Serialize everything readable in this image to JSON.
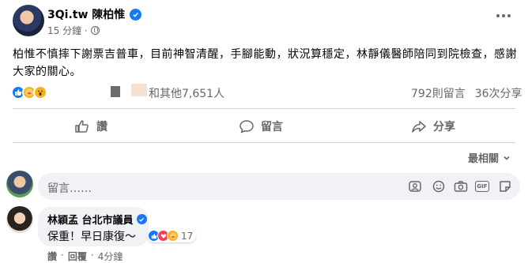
{
  "post": {
    "author": "3Qi.tw 陳柏惟",
    "time": "15 分鐘 ·",
    "text": "柏惟不慎摔下謝票吉普車，目前神智清醒，手腳能動，狀況算穩定，林靜儀醫師陪同到院檢查，感謝大家的關心。"
  },
  "reactions": {
    "icons": [
      "like-icon",
      "care-icon",
      "wow-icon"
    ],
    "others_text": "和其他7,651人",
    "comments_count": "792則留言",
    "shares_count": "36次分享"
  },
  "actions": {
    "like_label": "讚",
    "comment_label": "留言",
    "share_label": "分享"
  },
  "sort": {
    "label": "最相關"
  },
  "composer": {
    "placeholder": "留言……"
  },
  "comment": {
    "author": "林穎孟 台北市議員",
    "text": "保重！早日康復～",
    "reaction_count": "17",
    "like_label": "讚",
    "reply_label": "回覆",
    "time": "4分鐘"
  },
  "colors": {
    "accent": "#1877f2",
    "muted": "#65676b",
    "divider": "#ced0d4",
    "bubble": "#f0f2f5"
  }
}
